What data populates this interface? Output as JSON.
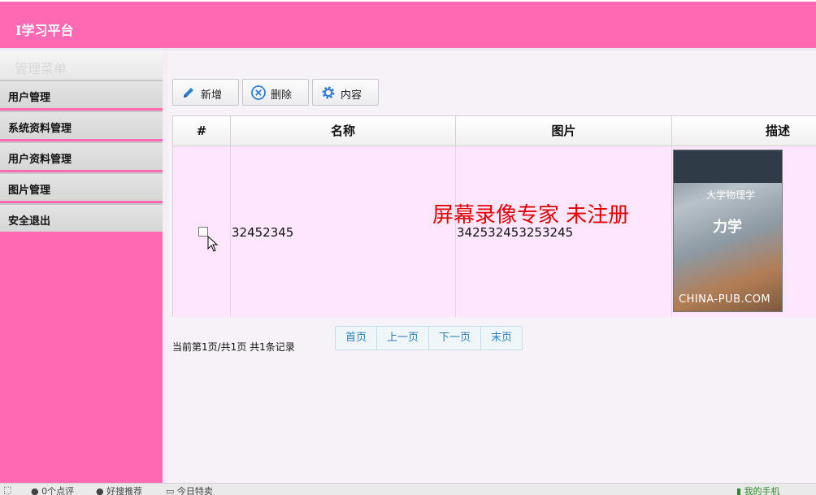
{
  "app": {
    "title": "I学习平台"
  },
  "sidebar": {
    "header": "管理菜单",
    "items": [
      {
        "label": "用户管理"
      },
      {
        "label": "系统资料管理"
      },
      {
        "label": "用户资料管理"
      },
      {
        "label": "图片管理"
      },
      {
        "label": "安全退出"
      }
    ]
  },
  "toolbar": {
    "add_label": "新增",
    "delete_label": "删除",
    "content_label": "内容"
  },
  "table": {
    "columns": [
      "#",
      "名称",
      "图片",
      "描述"
    ],
    "rows": [
      {
        "checked": false,
        "name": "32452345",
        "image_text": "342532453253245",
        "cover": {
          "title": "大学物理学",
          "main": "力学",
          "footer": "CHINA-PUB.COM"
        }
      }
    ]
  },
  "pagination": {
    "info": "当前第1页/共1页  共1条记录",
    "first": "首页",
    "prev": "上一页",
    "next": "下一页",
    "last": "末页"
  },
  "watermark": "屏幕录像专家  未注册",
  "statusbar": {
    "item1": "0个点评",
    "item2": "好搜推荐",
    "item3": "今日特卖",
    "item4": "我的手机"
  },
  "colors": {
    "brand": "#ff69b4",
    "row_bg": "#ffe6ff",
    "link": "#2c7fb0",
    "watermark": "#e00000"
  },
  "icons": {
    "add": "pencil-icon",
    "delete": "circle-x-icon",
    "content": "gear-icon"
  }
}
